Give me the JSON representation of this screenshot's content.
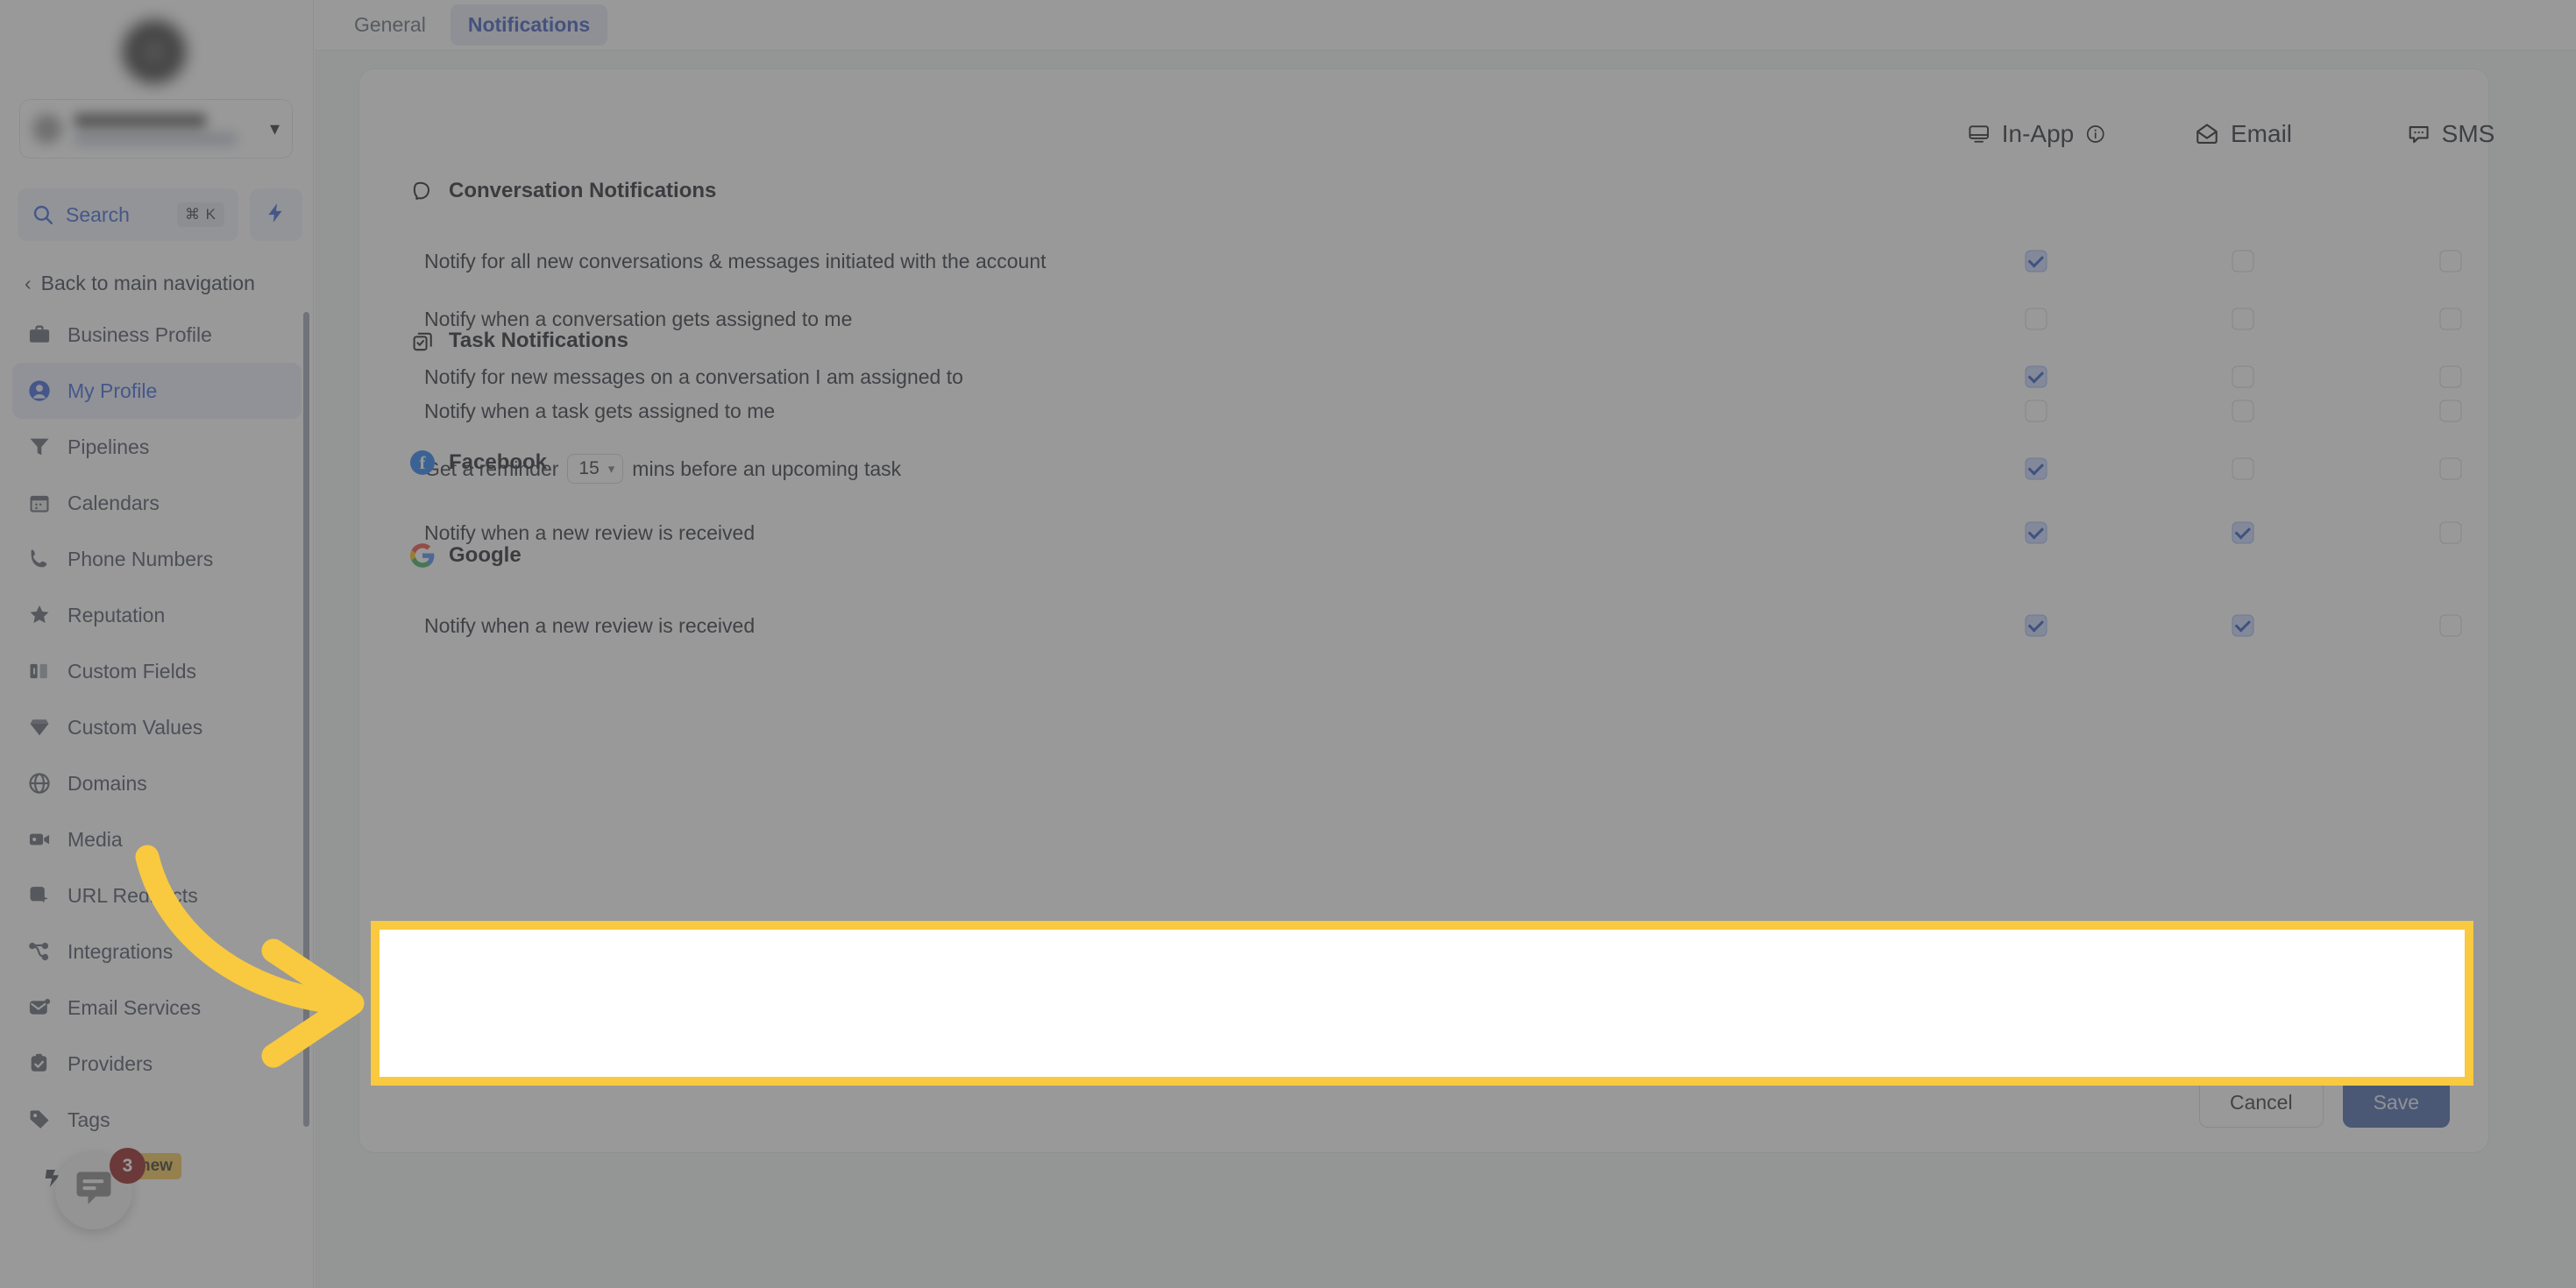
{
  "sidebar": {
    "search": {
      "label": "Search",
      "shortcut": "⌘ K"
    },
    "back_nav": {
      "label": "Back to main navigation"
    },
    "items": [
      {
        "label": "Business Profile",
        "icon": "briefcase-icon",
        "active": false
      },
      {
        "label": "My Profile",
        "icon": "user-circle-icon",
        "active": true
      },
      {
        "label": "Pipelines",
        "icon": "funnel-icon",
        "active": false
      },
      {
        "label": "Calendars",
        "icon": "calendar-icon",
        "active": false
      },
      {
        "label": "Phone Numbers",
        "icon": "phone-icon",
        "active": false
      },
      {
        "label": "Reputation",
        "icon": "star-icon",
        "active": false
      },
      {
        "label": "Custom Fields",
        "icon": "columns-icon",
        "active": false
      },
      {
        "label": "Custom Values",
        "icon": "gem-icon",
        "active": false
      },
      {
        "label": "Domains",
        "icon": "globe-icon",
        "active": false
      },
      {
        "label": "Media",
        "icon": "video-camera-icon",
        "active": false
      },
      {
        "label": "URL Redirects",
        "icon": "cursor-square-icon",
        "active": false
      },
      {
        "label": "Integrations",
        "icon": "share-nodes-icon",
        "active": false
      },
      {
        "label": "Email Services",
        "icon": "envelope-dot-icon",
        "active": false
      },
      {
        "label": "Providers",
        "icon": "clipboard-check-icon",
        "active": false
      },
      {
        "label": "Tags",
        "icon": "tag-icon",
        "active": false
      }
    ],
    "new_badge": "new",
    "chat_widget": {
      "unread_count": "3"
    }
  },
  "tabs": [
    {
      "label": "General",
      "active": false
    },
    {
      "label": "Notifications",
      "active": true
    }
  ],
  "columns": [
    {
      "label": "In-App",
      "icon": "monitor-icon",
      "info": true
    },
    {
      "label": "Email",
      "icon": "envelope-open-icon",
      "info": false
    },
    {
      "label": "SMS",
      "icon": "chat-dots-icon",
      "info": false
    }
  ],
  "sections": [
    {
      "title": "Conversation Notifications",
      "icon": "chat-bubble-icon",
      "rows": [
        {
          "label": "Notify for all new conversations & messages initiated with the account",
          "in_app": true,
          "email": false,
          "sms": false
        },
        {
          "label": "Notify when a conversation gets assigned to me",
          "in_app": false,
          "email": false,
          "sms": false
        },
        {
          "label": "Notify for new messages on a conversation I am assigned to",
          "in_app": true,
          "email": false,
          "sms": false
        }
      ]
    },
    {
      "title": "Task Notifications",
      "icon": "task-copy-icon",
      "rows": [
        {
          "label": "Notify when a task gets assigned to me",
          "in_app": false,
          "email": false,
          "sms": false
        },
        {
          "label_before": "Get a reminder",
          "reminder_value": "15",
          "label_after": "mins before an upcoming task",
          "in_app": true,
          "email": false,
          "sms": false
        }
      ]
    },
    {
      "title": "Facebook",
      "icon": "facebook-icon",
      "rows": [
        {
          "label": "Notify when a new review is received",
          "in_app": true,
          "email": true,
          "sms": false
        }
      ]
    },
    {
      "title": "Google",
      "icon": "google-icon",
      "highlighted": true,
      "rows": [
        {
          "label": "Notify when a new review is received",
          "in_app": true,
          "email": true,
          "sms": false
        }
      ]
    }
  ],
  "footer": {
    "cancel_label": "Cancel",
    "save_label": "Save"
  },
  "colors": {
    "accent_blue": "#2f5bd8",
    "highlight_yellow": "#f9c93f",
    "save_button": "#3b5ca8",
    "checkbox_fill": "#c8d8fd",
    "checkbox_check": "#1f4fc4",
    "badge_red": "#8d1111"
  }
}
